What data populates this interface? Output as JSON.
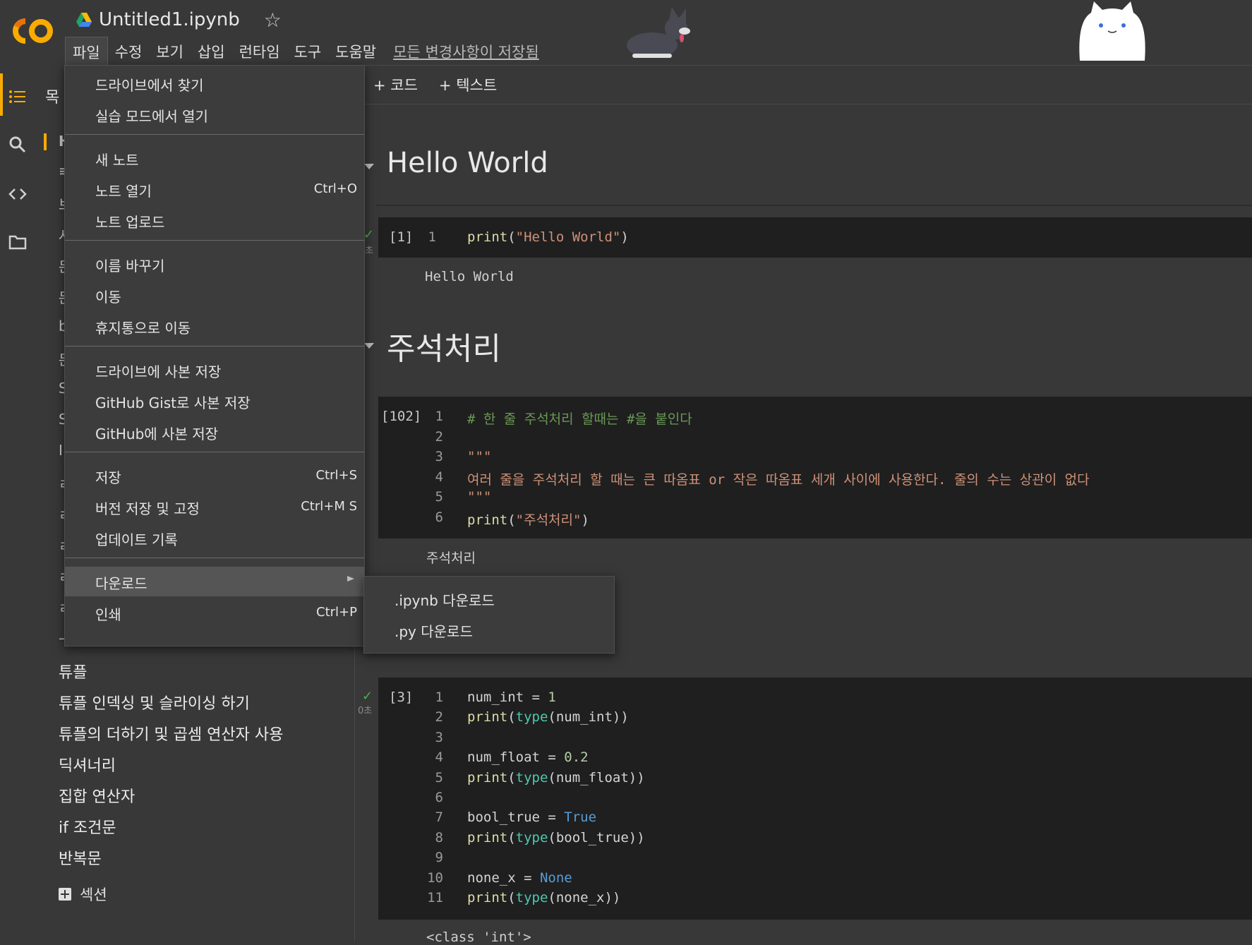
{
  "header": {
    "file_title": "Untitled1.ipynb",
    "menu": [
      "파일",
      "수정",
      "보기",
      "삽입",
      "런타임",
      "도구",
      "도움말"
    ],
    "saved_status": "모든 변경사항이 저장됨"
  },
  "toc": {
    "title_partial": "목",
    "stubs": [
      "H",
      "≡",
      "브",
      "사",
      "문",
      "문",
      "b",
      "문",
      "S",
      "S",
      "I",
      "ㄹ",
      "ㄹ",
      "ㄹ",
      "ㄹ",
      "ㄹ",
      "ㅡ"
    ],
    "items": [
      "튜플",
      "튜플 인덱싱 및 슬라이싱 하기",
      "튜플의 더하기 및 곱셈 연산자 사용",
      "딕셔너리",
      "집합 연산자",
      "if 조건문",
      "반복문"
    ],
    "add_section_label": "섹션"
  },
  "toolbar": {
    "add_code": "+ 코드",
    "add_text": "+ 텍스트"
  },
  "file_menu": {
    "groups": [
      [
        {
          "label": "드라이브에서 찾기",
          "shortcut": ""
        },
        {
          "label": "실습 모드에서 열기",
          "shortcut": ""
        }
      ],
      [
        {
          "label": "새 노트",
          "shortcut": ""
        },
        {
          "label": "노트 열기",
          "shortcut": "Ctrl+O"
        },
        {
          "label": "노트 업로드",
          "shortcut": ""
        }
      ],
      [
        {
          "label": "이름 바꾸기",
          "shortcut": ""
        },
        {
          "label": "이동",
          "shortcut": ""
        },
        {
          "label": "휴지통으로 이동",
          "shortcut": ""
        }
      ],
      [
        {
          "label": "드라이브에 사본 저장",
          "shortcut": ""
        },
        {
          "label": "GitHub Gist로 사본 저장",
          "shortcut": ""
        },
        {
          "label": "GitHub에 사본 저장",
          "shortcut": ""
        }
      ],
      [
        {
          "label": "저장",
          "shortcut": "Ctrl+S"
        },
        {
          "label": "버전 저장 및 고정",
          "shortcut": "Ctrl+M S"
        },
        {
          "label": "업데이트 기록",
          "shortcut": ""
        }
      ],
      [
        {
          "label": "다운로드",
          "shortcut": ""
        },
        {
          "label": "인쇄",
          "shortcut": "Ctrl+P"
        }
      ]
    ],
    "download_submenu": [
      ".ipynb 다운로드",
      ".py 다운로드"
    ]
  },
  "notebook": {
    "heading1": "Hello World",
    "cell1": {
      "count": "[1]",
      "lines": [
        [
          [
            "fn",
            "print"
          ],
          [
            "plain",
            "("
          ],
          [
            "str",
            "\"Hello World\""
          ],
          [
            "plain",
            ")"
          ]
        ]
      ],
      "output": "Hello World",
      "duration": "초"
    },
    "heading2": "주석처리",
    "cell2": {
      "count": "[102]",
      "lines": [
        [
          [
            "com",
            "# 한 줄 주석처리 할때는 #을 붙인다"
          ]
        ],
        [],
        [
          [
            "str",
            "\"\"\""
          ]
        ],
        [
          [
            "str",
            "여러 줄을 주석처리 할 때는 큰 따옴표 or 작은 따옴표 세개 사이에 사용한다. 줄의 수는 상관이 없다"
          ]
        ],
        [
          [
            "str",
            "\"\"\""
          ]
        ],
        [
          [
            "fn",
            "print"
          ],
          [
            "plain",
            "("
          ],
          [
            "str",
            "\"주석처리\""
          ],
          [
            "plain",
            ")"
          ]
        ]
      ],
      "output": "주석처리"
    },
    "cell3": {
      "count": "[3]",
      "duration": "0초",
      "lines": [
        [
          [
            "plain",
            "num_int = "
          ],
          [
            "num",
            "1"
          ]
        ],
        [
          [
            "fn",
            "print"
          ],
          [
            "plain",
            "("
          ],
          [
            "bi",
            "type"
          ],
          [
            "plain",
            "(num_int))"
          ]
        ],
        [],
        [
          [
            "plain",
            "num_float = "
          ],
          [
            "num",
            "0.2"
          ]
        ],
        [
          [
            "fn",
            "print"
          ],
          [
            "plain",
            "("
          ],
          [
            "bi",
            "type"
          ],
          [
            "plain",
            "(num_float))"
          ]
        ],
        [],
        [
          [
            "plain",
            "bool_true = "
          ],
          [
            "kw",
            "True"
          ]
        ],
        [
          [
            "fn",
            "print"
          ],
          [
            "plain",
            "("
          ],
          [
            "bi",
            "type"
          ],
          [
            "plain",
            "(bool_true))"
          ]
        ],
        [],
        [
          [
            "plain",
            "none_x = "
          ],
          [
            "kw",
            "None"
          ]
        ],
        [
          [
            "fn",
            "print"
          ],
          [
            "plain",
            "("
          ],
          [
            "bi",
            "type"
          ],
          [
            "plain",
            "(none_x))"
          ]
        ]
      ],
      "output": "<class 'int'>"
    }
  }
}
